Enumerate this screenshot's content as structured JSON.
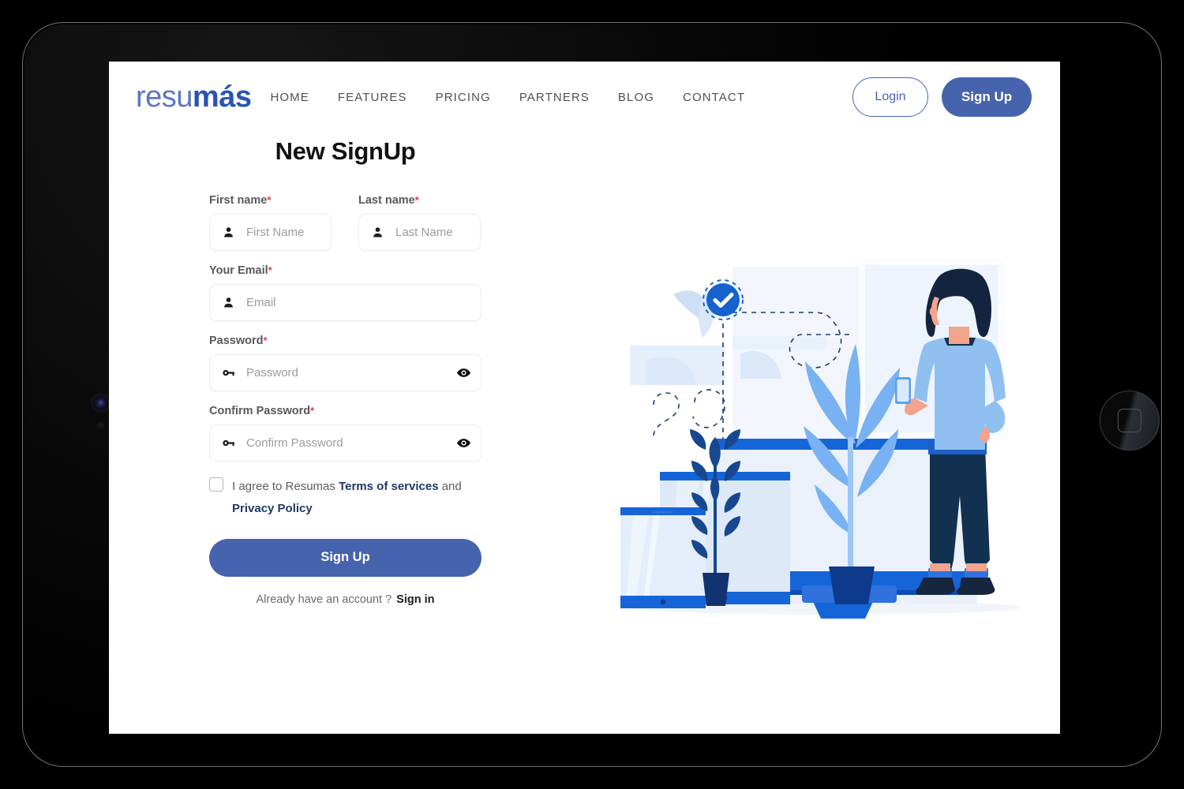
{
  "brand": {
    "logo_light": "resu",
    "logo_bold": "más"
  },
  "nav": {
    "links": [
      {
        "label": "HOME",
        "name": "home"
      },
      {
        "label": "FEATURES",
        "name": "features"
      },
      {
        "label": "PRICING",
        "name": "pricing"
      },
      {
        "label": "PARTNERS",
        "name": "partners"
      },
      {
        "label": "BLOG",
        "name": "blog"
      },
      {
        "label": "CONTACT",
        "name": "contact"
      }
    ],
    "login_label": "Login",
    "signup_label": "Sign Up"
  },
  "form": {
    "title": "New SignUp",
    "required_mark": "*",
    "fields": {
      "first_name": {
        "label": "First name",
        "placeholder": "First Name",
        "value": "",
        "icon": "person-icon"
      },
      "last_name": {
        "label": "Last name",
        "placeholder": "Last Name",
        "value": "",
        "icon": "person-icon"
      },
      "email": {
        "label": "Your Email",
        "placeholder": "Email",
        "value": "",
        "icon": "person-icon"
      },
      "password": {
        "label": "Password",
        "placeholder": "Password",
        "value": "",
        "icon": "key-icon",
        "toggle_icon": "eye-icon"
      },
      "confirm_password": {
        "label": "Confirm Password",
        "placeholder": "Confirm Password",
        "value": "",
        "icon": "key-icon",
        "toggle_icon": "eye-icon"
      }
    },
    "terms": {
      "checked": false,
      "text_before": "I agree to Resumas",
      "link_terms": "Terms of services",
      "text_middle": "and",
      "link_privacy": "Privacy Policy"
    },
    "submit_label": "Sign Up",
    "signin_prompt": "Already have an account ?",
    "signin_label": "Sign in"
  },
  "illustration": {
    "name": "signup-devices-illustration",
    "alt": "Woman with phone standing beside desktop monitor, tablet and smartphone with verified check badge"
  },
  "colors": {
    "brand_blue": "#4663ad",
    "logo_light_blue": "#5b77c4",
    "logo_dark_blue": "#2a53b8",
    "accent_blue": "#1565d8",
    "required_red": "#e8384f",
    "link_navy": "#1f3864",
    "label_gray": "#56595e",
    "placeholder_gray": "#9b9b9b"
  }
}
